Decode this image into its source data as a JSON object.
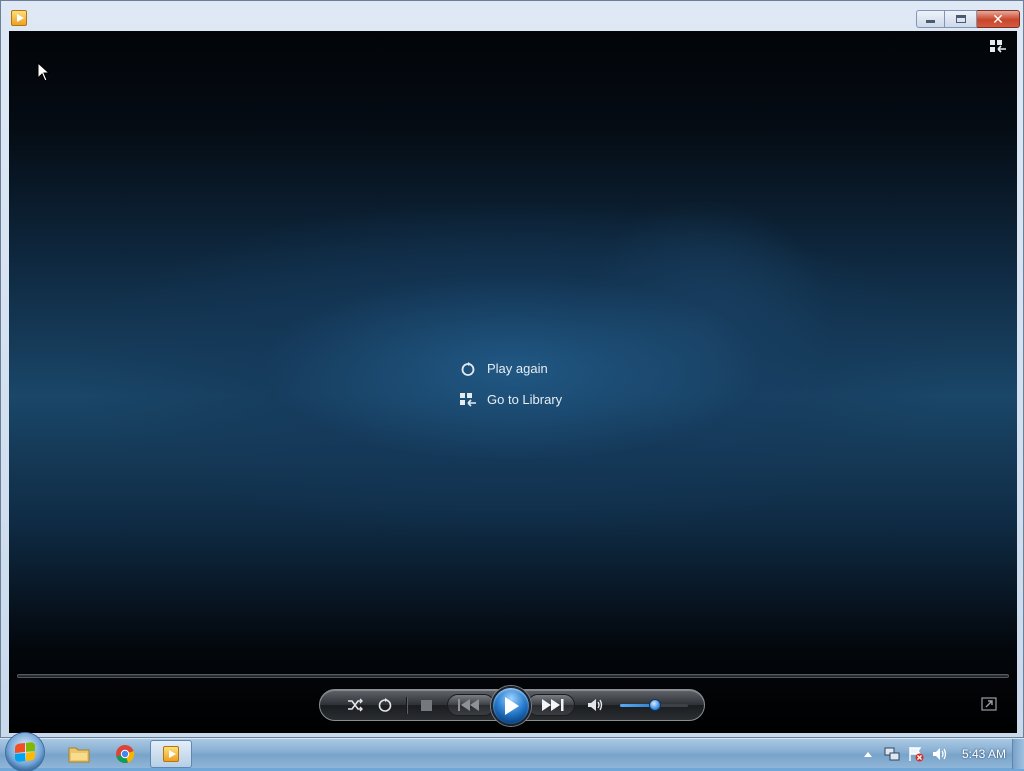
{
  "window": {
    "app_icon": "media-player-icon",
    "caption_buttons": [
      "minimize-icon",
      "maximize-icon",
      "close-icon"
    ]
  },
  "player": {
    "menu": [
      {
        "label": "Play again",
        "icon": "replay-icon"
      },
      {
        "label": "Go to Library",
        "icon": "library-icon"
      }
    ],
    "controls": [
      "shuffle-icon",
      "repeat-icon",
      "stop-icon",
      "previous-icon",
      "play-icon",
      "next-icon",
      "volume-icon"
    ],
    "volume_level": 0.5
  },
  "taskbar": {
    "apps": [
      "explorer-icon",
      "chrome-icon",
      "media-player-icon"
    ],
    "active_app": "media-player-icon",
    "tray_icons": [
      "show-hidden-icons-arrow",
      "network-icon",
      "action-center-flag-icon",
      "speaker-icon"
    ],
    "clock": "5:43 AM"
  },
  "colors": {
    "play_button": "#2a7ed0",
    "stage_background": "#1a4668",
    "taskbar": "#86aed2"
  }
}
